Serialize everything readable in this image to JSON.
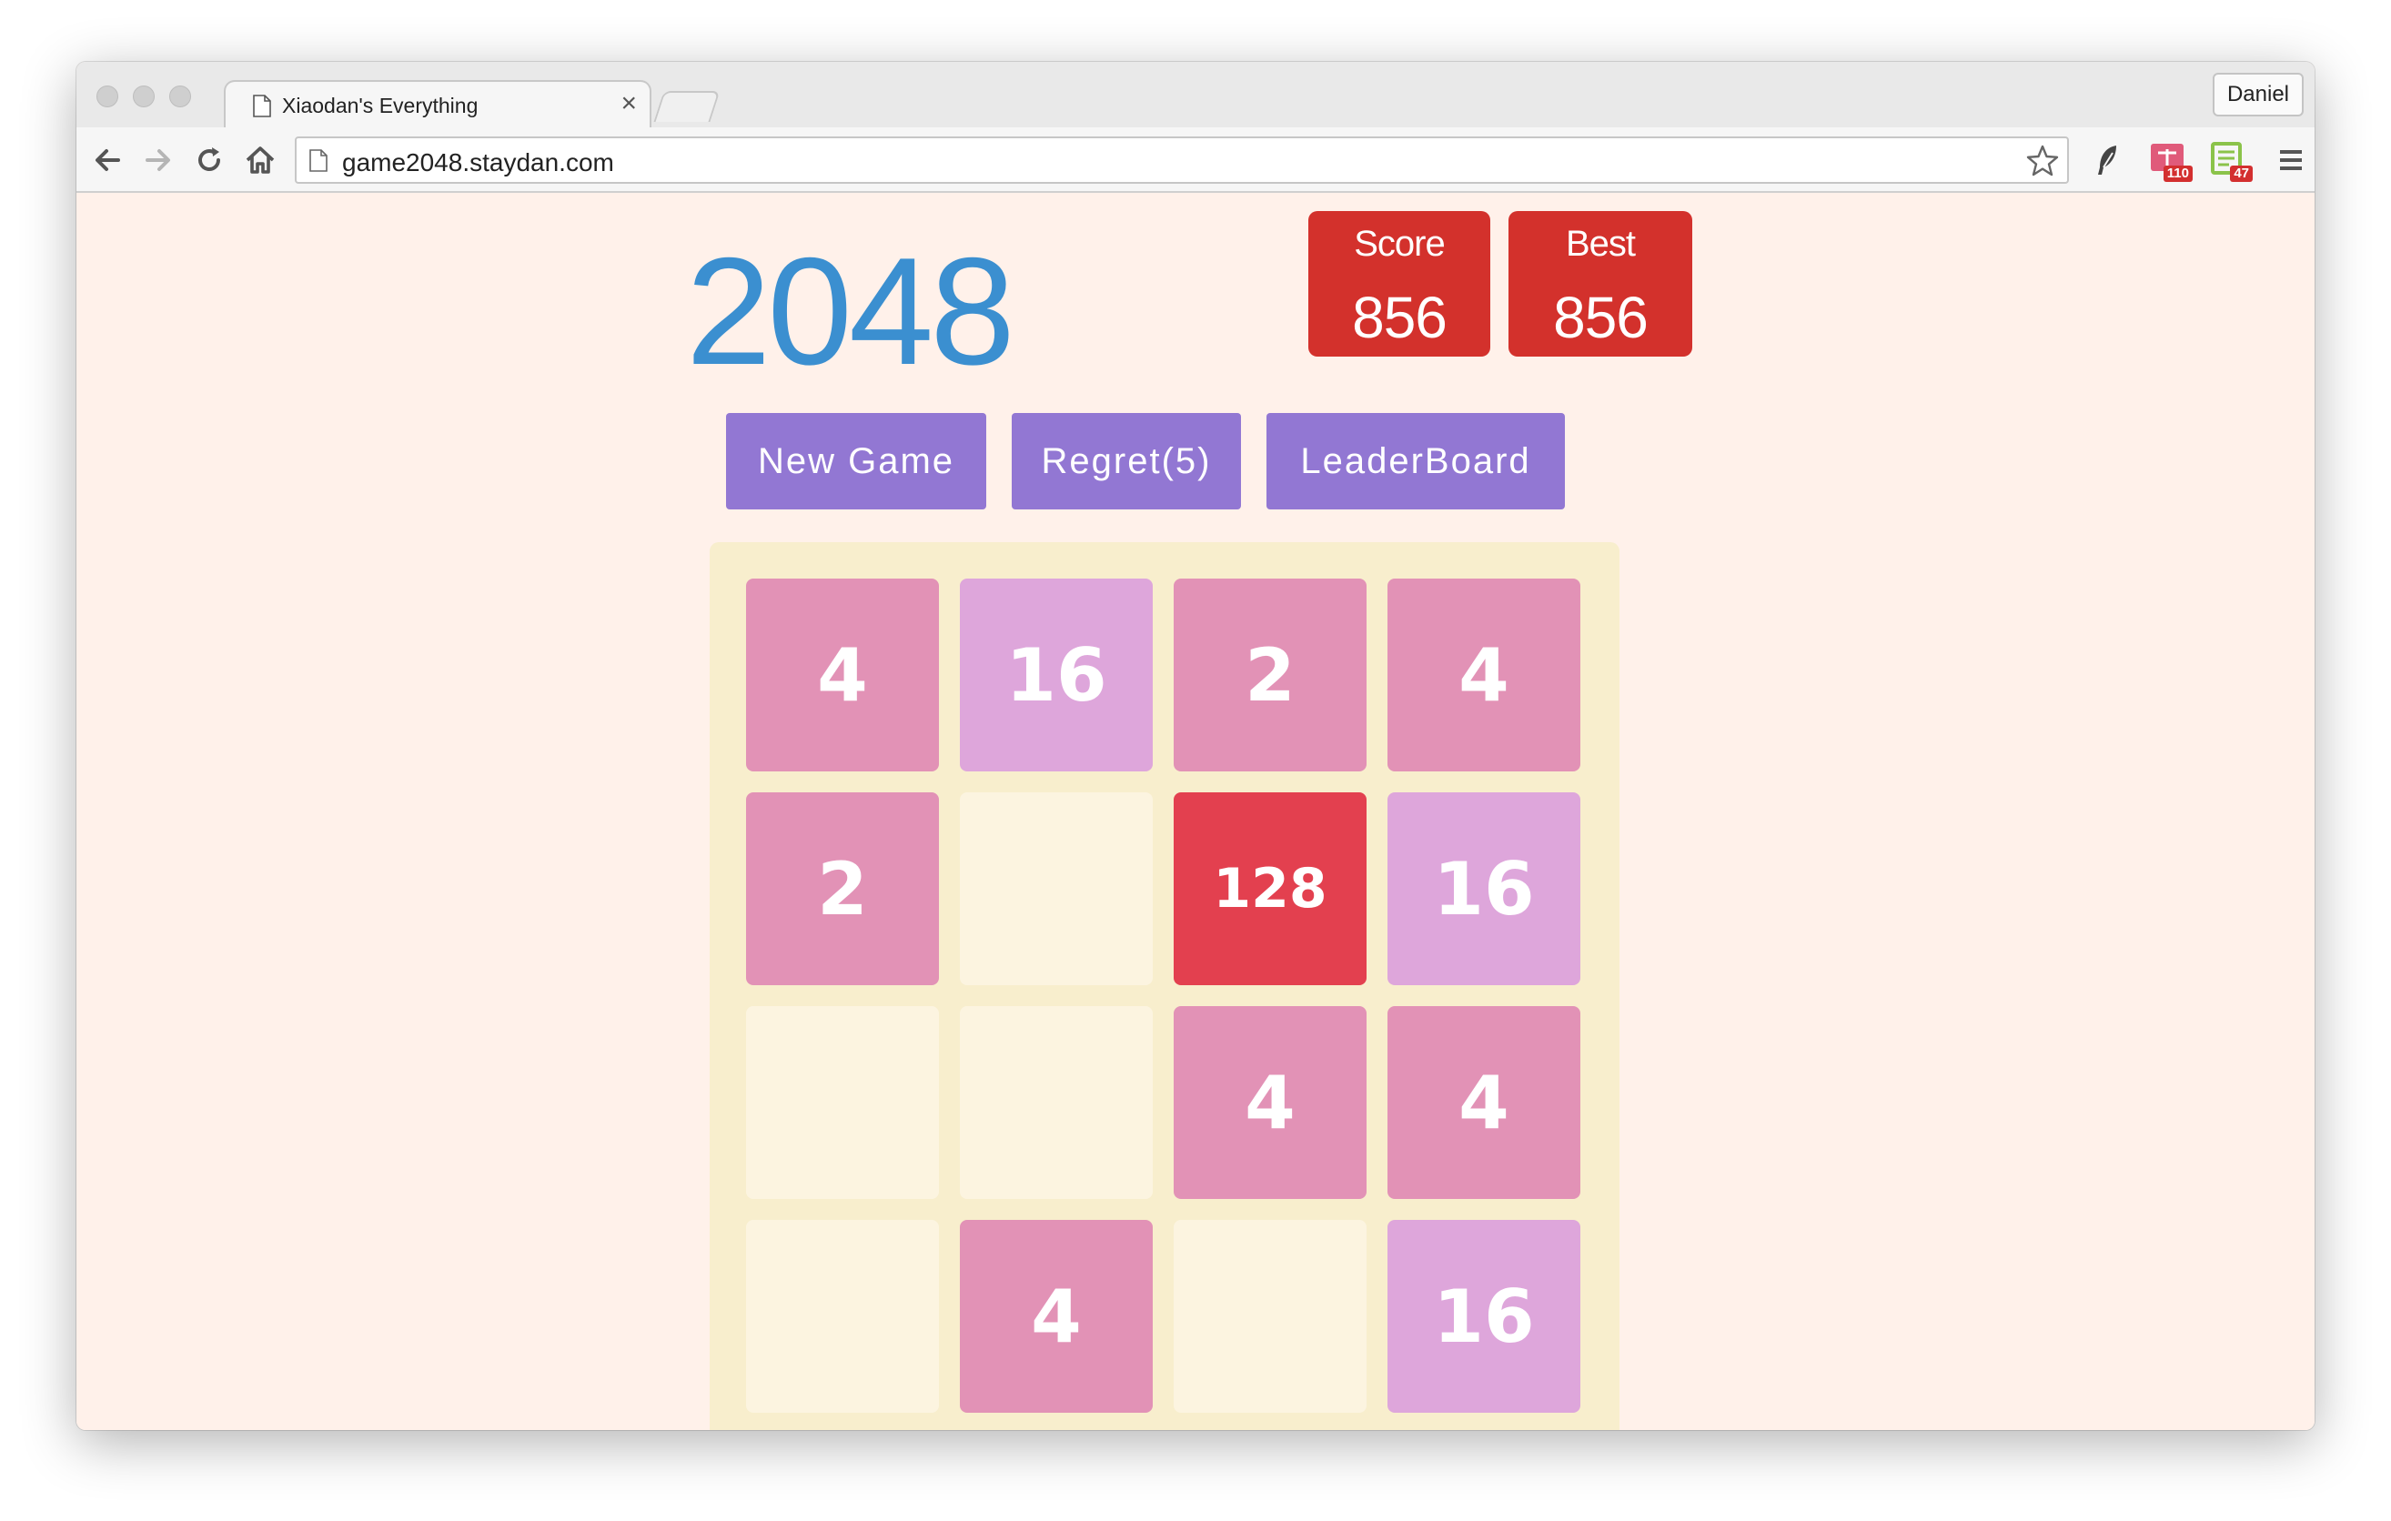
{
  "browser": {
    "tab_title": "Xiaodan's Everything",
    "tab_close": "×",
    "profile_name": "Daniel",
    "url": "game2048.staydan.com",
    "extensions": [
      {
        "name": "ext-badge-red-icon",
        "badge": "110"
      },
      {
        "name": "ext-badge-green-icon",
        "badge": "47"
      }
    ]
  },
  "game": {
    "title": "2048",
    "score_label": "Score",
    "score_value": "856",
    "best_label": "Best",
    "best_value": "856",
    "buttons": {
      "new_game": "New Game",
      "regret": "Regret(5)",
      "leaderboard": "LeaderBoard"
    },
    "board": [
      [
        4,
        16,
        2,
        4
      ],
      [
        2,
        null,
        128,
        16
      ],
      [
        null,
        null,
        4,
        4
      ],
      [
        null,
        4,
        null,
        16
      ]
    ],
    "tile_colors": {
      "2": "#e292b6",
      "4": "#e292b6",
      "16": "#dea6db",
      "128": "#e3404f",
      "empty": "#fcf4e0"
    }
  }
}
